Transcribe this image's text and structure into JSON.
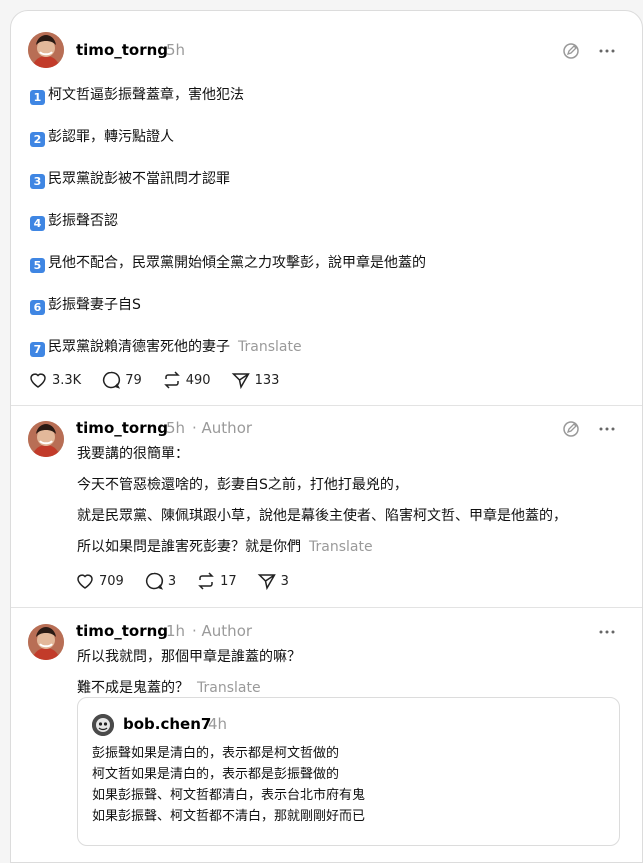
{
  "post1": {
    "username": "timo_torng",
    "time": "5h",
    "lines": [
      {
        "num": "1",
        "text": "柯文哲逼彭振聲蓋章，害他犯法"
      },
      {
        "num": "2",
        "text": "彭認罪，轉污點證人"
      },
      {
        "num": "3",
        "text": "民眾黨說彭被不當訊問才認罪"
      },
      {
        "num": "4",
        "text": "彭振聲否認"
      },
      {
        "num": "5",
        "text": "見他不配合，民眾黨開始傾全黨之力攻擊彭，說甲章是他蓋的"
      },
      {
        "num": "6",
        "text": "彭振聲妻子自S"
      },
      {
        "num": "7",
        "text": "民眾黨說賴清德害死他的妻子"
      }
    ],
    "translate": "Translate",
    "likes": "3.3K",
    "comments": "79",
    "reposts": "490",
    "shares": "133"
  },
  "post2": {
    "username": "timo_torng",
    "time": "5h",
    "author_label": "· Author",
    "lines": [
      "我要講的很簡單：",
      "今天不管惡檢還啥的，彭妻自S之前，打他打最兇的，",
      "就是民眾黨、陳佩琪跟小草，說他是幕後主使者、陷害柯文哲、甲章是他蓋的，",
      "所以如果問是誰害死彭妻？就是你們"
    ],
    "translate": "Translate",
    "likes": "709",
    "comments": "3",
    "reposts": "17",
    "shares": "3"
  },
  "post3": {
    "username": "timo_torng",
    "time": "1h",
    "author_label": "· Author",
    "lines": [
      "所以我就問，那個甲章是誰蓋的嘛？",
      "難不成是鬼蓋的？"
    ],
    "translate": "Translate",
    "quote": {
      "username": "bob.chen7",
      "time": "4h",
      "lines": [
        "彭振聲如果是清白的，表示都是柯文哲做的",
        "柯文哲如果是清白的，表示都是彭振聲做的",
        "如果彭振聲、柯文哲都清白，表示台北市府有鬼",
        "如果彭振聲、柯文哲都不清白，那就剛剛好而已"
      ]
    }
  },
  "colors": {
    "accent_number_badge": "#3f86e3",
    "muted_text": "#9a9a9a"
  }
}
